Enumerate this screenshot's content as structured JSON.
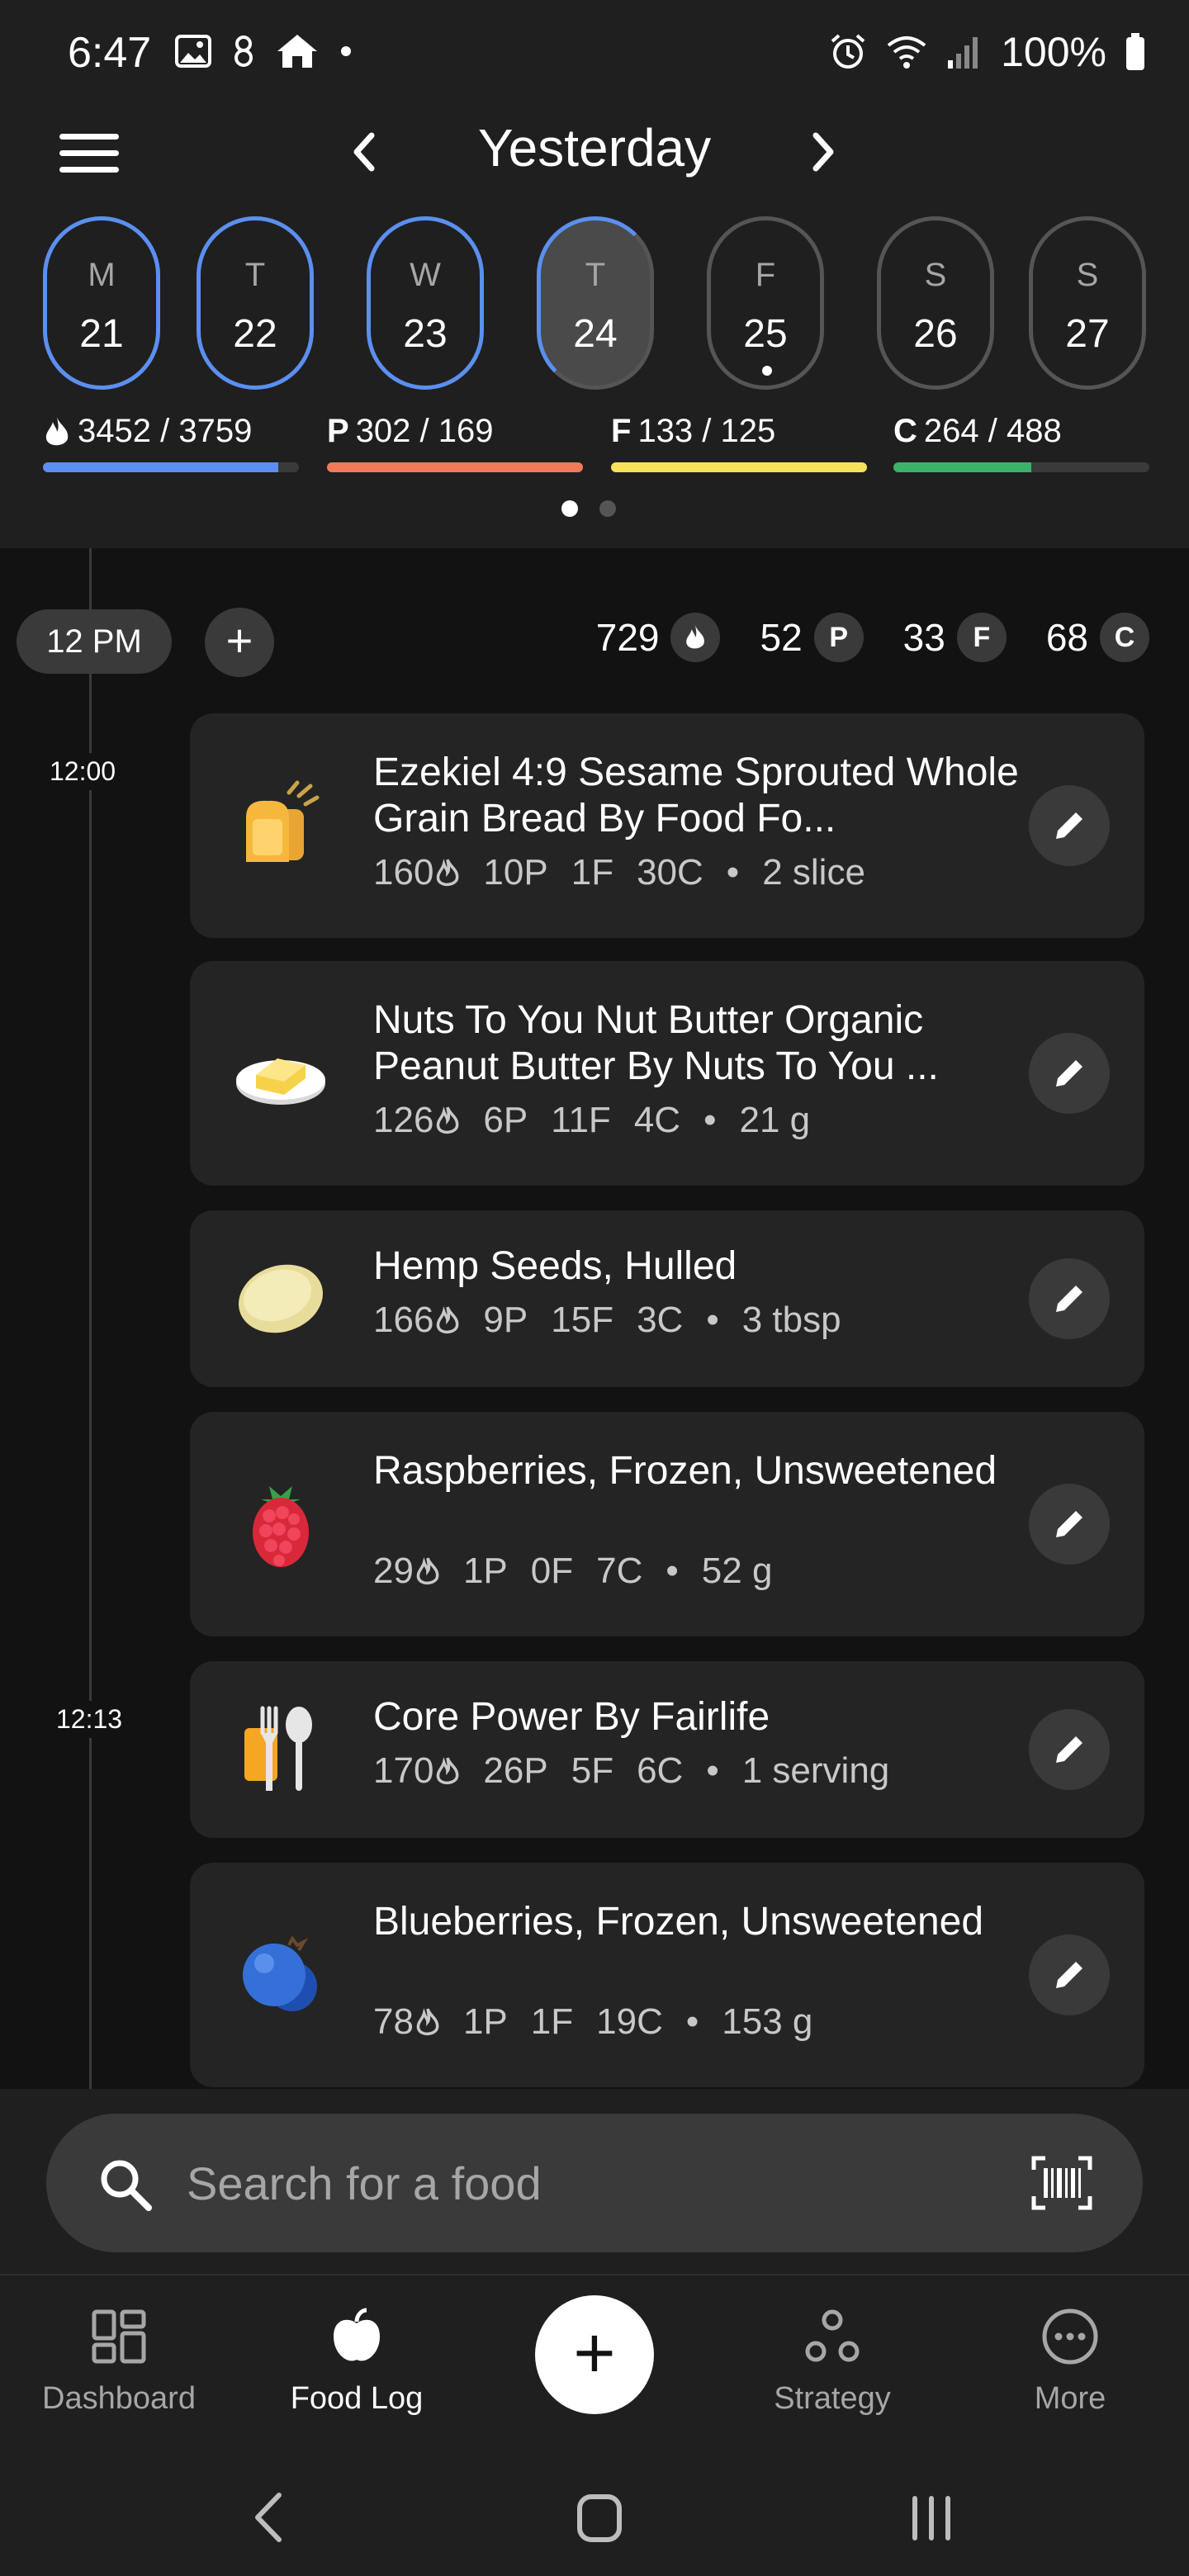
{
  "status_bar": {
    "time": "6:47",
    "battery": "100%"
  },
  "header": {
    "title": "Yesterday"
  },
  "week": [
    {
      "letter": "M",
      "num": "21",
      "state": "filled"
    },
    {
      "letter": "T",
      "num": "22",
      "state": "filled"
    },
    {
      "letter": "W",
      "num": "23",
      "state": "filled"
    },
    {
      "letter": "T",
      "num": "24",
      "state": "selected"
    },
    {
      "letter": "F",
      "num": "25",
      "state": "today"
    },
    {
      "letter": "S",
      "num": "26",
      "state": "empty"
    },
    {
      "letter": "S",
      "num": "27",
      "state": "empty"
    }
  ],
  "macros": {
    "energy": {
      "value": "3452 / 3759",
      "progress": 0.92,
      "color": "#5b8ff0"
    },
    "protein": {
      "letter": "P",
      "value": "302 / 169",
      "progress": 1.0,
      "color": "#f07a5a"
    },
    "fat": {
      "letter": "F",
      "value": "133 / 125",
      "progress": 1.0,
      "color": "#f5e15a"
    },
    "carbs": {
      "letter": "C",
      "value": "264 / 488",
      "progress": 0.54,
      "color": "#3bb26a"
    }
  },
  "group": {
    "time": "12 PM",
    "add": "+",
    "totals": {
      "calories": "729",
      "protein": "52",
      "fat": "33",
      "carbs": "68",
      "p": "P",
      "f": "F",
      "c": "C"
    }
  },
  "time_labels": {
    "first": "12:00",
    "second": "12:13"
  },
  "foods": [
    {
      "name": "Ezekiel 4:9 Sesame Sprouted Whole Grain Bread By Food Fo...",
      "cal": "160",
      "p": "10P",
      "f": "1F",
      "c": "30C",
      "serving": "2 slice",
      "icon": "bread-icon"
    },
    {
      "name": "Nuts To You Nut Butter Organic Peanut Butter By Nuts To You ...",
      "cal": "126",
      "p": "6P",
      "f": "11F",
      "c": "4C",
      "serving": "21 g",
      "icon": "butter-icon"
    },
    {
      "name": "Hemp Seeds, Hulled",
      "cal": "166",
      "p": "9P",
      "f": "15F",
      "c": "3C",
      "serving": "3 tbsp",
      "icon": "seed-icon"
    },
    {
      "name": "Raspberries, Frozen, Unsweetened",
      "cal": "29",
      "p": "1P",
      "f": "0F",
      "c": "7C",
      "serving": "52 g",
      "icon": "raspberry-icon"
    },
    {
      "name": "Core Power By Fairlife",
      "cal": "170",
      "p": "26P",
      "f": "5F",
      "c": "6C",
      "serving": "1 serving",
      "icon": "fork-spoon-icon"
    },
    {
      "name": "Blueberries, Frozen, Unsweetened",
      "cal": "78",
      "p": "1P",
      "f": "1F",
      "c": "19C",
      "serving": "153 g",
      "icon": "blueberry-icon"
    }
  ],
  "search": {
    "placeholder": "Search for a food"
  },
  "tabs": {
    "dashboard": "Dashboard",
    "food_log": "Food Log",
    "add": "+",
    "strategy": "Strategy",
    "more": "More"
  },
  "separator": "•"
}
